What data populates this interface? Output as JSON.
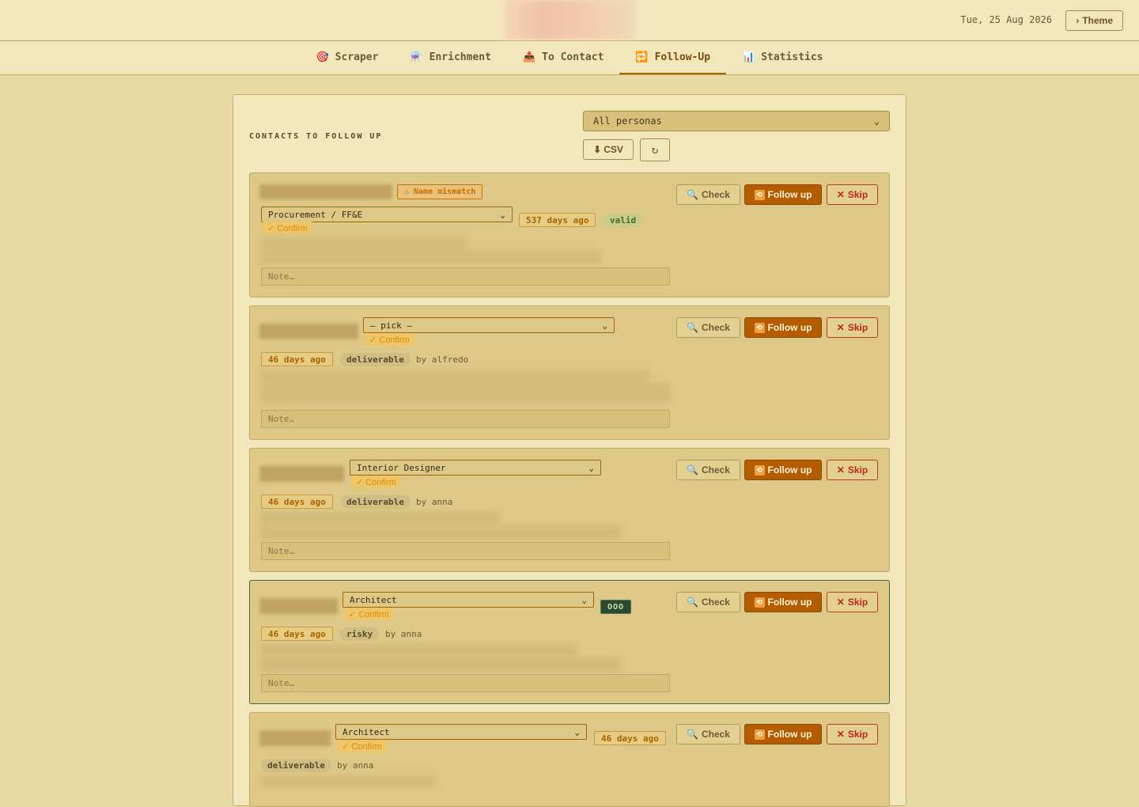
{
  "header": {
    "date": "Tue, 25 Aug 2026",
    "theme_label": "Theme",
    "theme_icon": "›"
  },
  "nav": {
    "tabs": [
      {
        "icon": "🎯",
        "label": "Scraper"
      },
      {
        "icon": "⚗️",
        "label": "Enrichment"
      },
      {
        "icon": "📤",
        "label": "To Contact"
      },
      {
        "icon": "🔁",
        "label": "Follow-Up"
      },
      {
        "icon": "📊",
        "label": "Statistics"
      }
    ],
    "active": "Follow-Up"
  },
  "panel": {
    "title": "CONTACTS TO FOLLOW UP",
    "persona_filter": "All personas",
    "csv_label": "CSV",
    "csv_icon": "⬇",
    "refresh_icon": "↻"
  },
  "actions": {
    "check": "Check",
    "follow_up": "Follow up",
    "skip": "Skip",
    "confirm": "✓ Confirm",
    "note_placeholder": "Note…"
  },
  "cards": [
    {
      "role": "Procurement / FF&E",
      "badge": "⚠ Name mismatch",
      "days": "537 days ago",
      "status": "valid",
      "by": ""
    },
    {
      "role": "— pick —",
      "days": "46 days ago",
      "status": "deliverable",
      "by": "by alfredo"
    },
    {
      "role": "Interior Designer",
      "days": "46 days ago",
      "status": "deliverable",
      "by": "by anna"
    },
    {
      "role": "Architect",
      "badge": "OOO",
      "days": "46 days ago",
      "status": "risky",
      "by": "by anna"
    },
    {
      "role": "Architect",
      "days": "46 days ago",
      "status": "deliverable",
      "by": "by anna"
    }
  ]
}
